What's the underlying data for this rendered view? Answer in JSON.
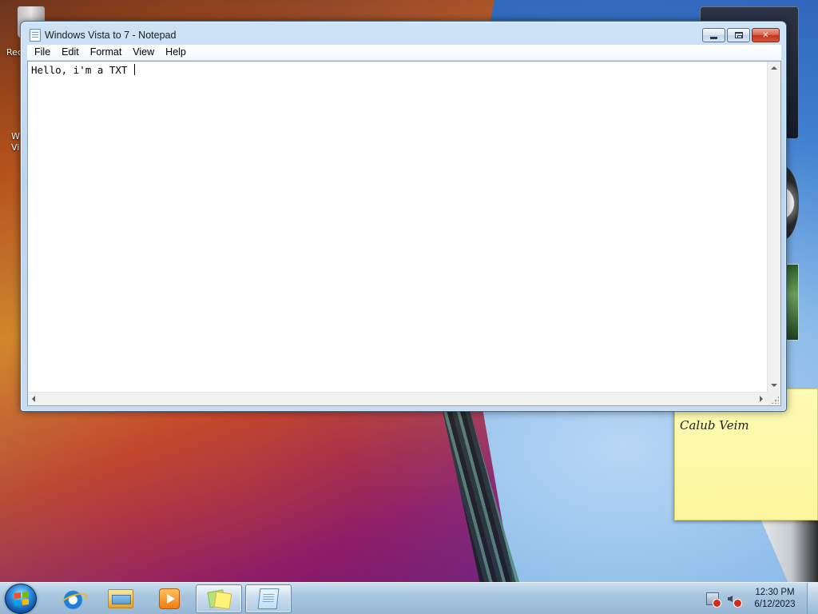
{
  "desktop": {
    "icon_labels": [
      "Rec",
      "W",
      "Vi"
    ]
  },
  "sticky_note": {
    "text": "Calub Veim"
  },
  "notepad": {
    "title": "Windows Vista to 7 - Notepad",
    "menu": [
      "File",
      "Edit",
      "Format",
      "View",
      "Help"
    ],
    "content": "Hello, i'm a TXT "
  },
  "taskbar": {
    "pinned": [
      "internet-explorer",
      "windows-explorer",
      "windows-media-player",
      "sticky-notes",
      "notepad"
    ],
    "active_app": "notepad",
    "clock": {
      "time": "12:30 PM",
      "date": "6/12/2023"
    }
  },
  "colors": {
    "taskbar": "#a9c6df",
    "close_button": "#c2361c",
    "sticky_note": "#fbf59c"
  }
}
